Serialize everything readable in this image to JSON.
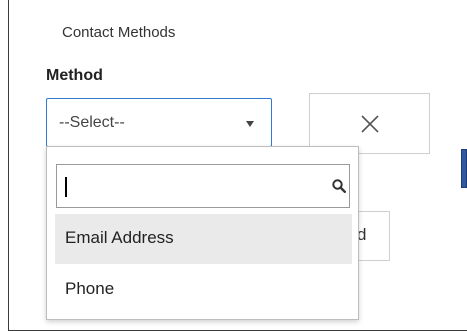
{
  "section": {
    "title": "Contact Methods"
  },
  "method_field": {
    "label": "Method",
    "selected_value": "--Select--"
  },
  "dropdown": {
    "search_value": "",
    "options": [
      {
        "label": "Email Address",
        "highlighted": true
      },
      {
        "label": "Phone",
        "highlighted": false
      }
    ]
  },
  "partially_hidden_button": {
    "visible_text": "d"
  },
  "icons": {
    "remove": "close-icon",
    "search": "search-icon",
    "caret": "caret-down-icon"
  },
  "colors": {
    "focus_border": "#2e7bcf",
    "highlight_bg": "#eaeaea",
    "accent_edge": "#2f5aa0"
  }
}
